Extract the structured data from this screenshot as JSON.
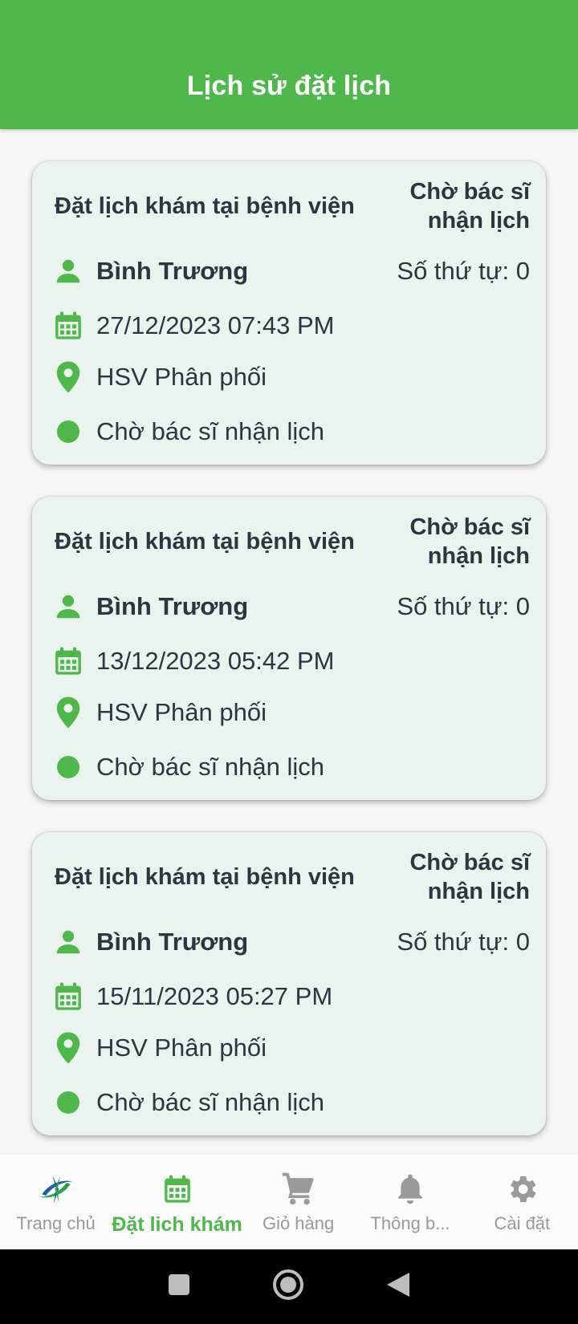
{
  "header": {
    "title": "Lịch sử đặt lịch"
  },
  "colors": {
    "brand": "#4eb94a",
    "card_bg": "#eaf3ee",
    "text": "#2f3440"
  },
  "cards": [
    {
      "title": "Đặt lịch khám tại bệnh viện",
      "status_top": "Chờ bác sĩ nhận lịch",
      "patient": "Bình Trương",
      "queue": "Số thứ tự: 0",
      "datetime": "27/12/2023 07:43 PM",
      "place": "HSV Phân phối",
      "state": "Chờ bác sĩ nhận lịch"
    },
    {
      "title": "Đặt lịch khám tại bệnh viện",
      "status_top": "Chờ bác sĩ nhận lịch",
      "patient": "Bình Trương",
      "queue": "Số thứ tự: 0",
      "datetime": "13/12/2023 05:42 PM",
      "place": "HSV Phân phối",
      "state": "Chờ bác sĩ nhận lịch"
    },
    {
      "title": "Đặt lịch khám tại bệnh viện",
      "status_top": "Chờ bác sĩ nhận lịch",
      "patient": "Bình Trương",
      "queue": "Số thứ tự: 0",
      "datetime": "15/11/2023 05:27 PM",
      "place": "HSV Phân phối",
      "state": "Chờ bác sĩ nhận lịch"
    }
  ],
  "icons": {
    "patient": "person-icon",
    "date": "calendar-icon",
    "place": "location-pin-icon",
    "state": "status-dot-icon"
  },
  "bottom_nav": [
    {
      "label": "Trang chủ",
      "icon": "app-logo-icon",
      "active": false
    },
    {
      "label": "Đặt lich khám",
      "icon": "calendar-icon",
      "active": true
    },
    {
      "label": "Giỏ hàng",
      "icon": "cart-icon",
      "active": false
    },
    {
      "label": "Thông b...",
      "icon": "bell-icon",
      "active": false
    },
    {
      "label": "Cài đặt",
      "icon": "gear-icon",
      "active": false
    }
  ],
  "system_nav": [
    "recents-button",
    "home-button",
    "back-button"
  ]
}
